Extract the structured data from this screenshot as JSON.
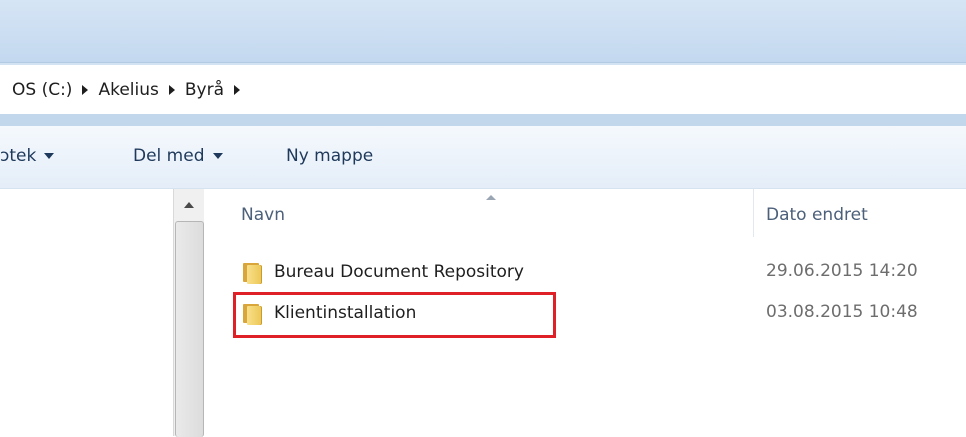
{
  "breadcrumb": [
    "OS (C:)",
    "Akelius",
    "Byrå"
  ],
  "toolbar": {
    "library_label": "ɔtek",
    "share_label": "Del med",
    "new_folder_label": "Ny mappe"
  },
  "columns": {
    "name": "Navn",
    "date": "Dato endret"
  },
  "files": [
    {
      "name": "Bureau Document Repository",
      "modified": "29.06.2015 14:20",
      "icon": "folder-icon"
    },
    {
      "name": "Klientinstallation",
      "modified": "03.08.2015 10:48",
      "icon": "folder-icon"
    }
  ],
  "colors": {
    "highlight": "#e02027",
    "folder": "#ecc656"
  }
}
